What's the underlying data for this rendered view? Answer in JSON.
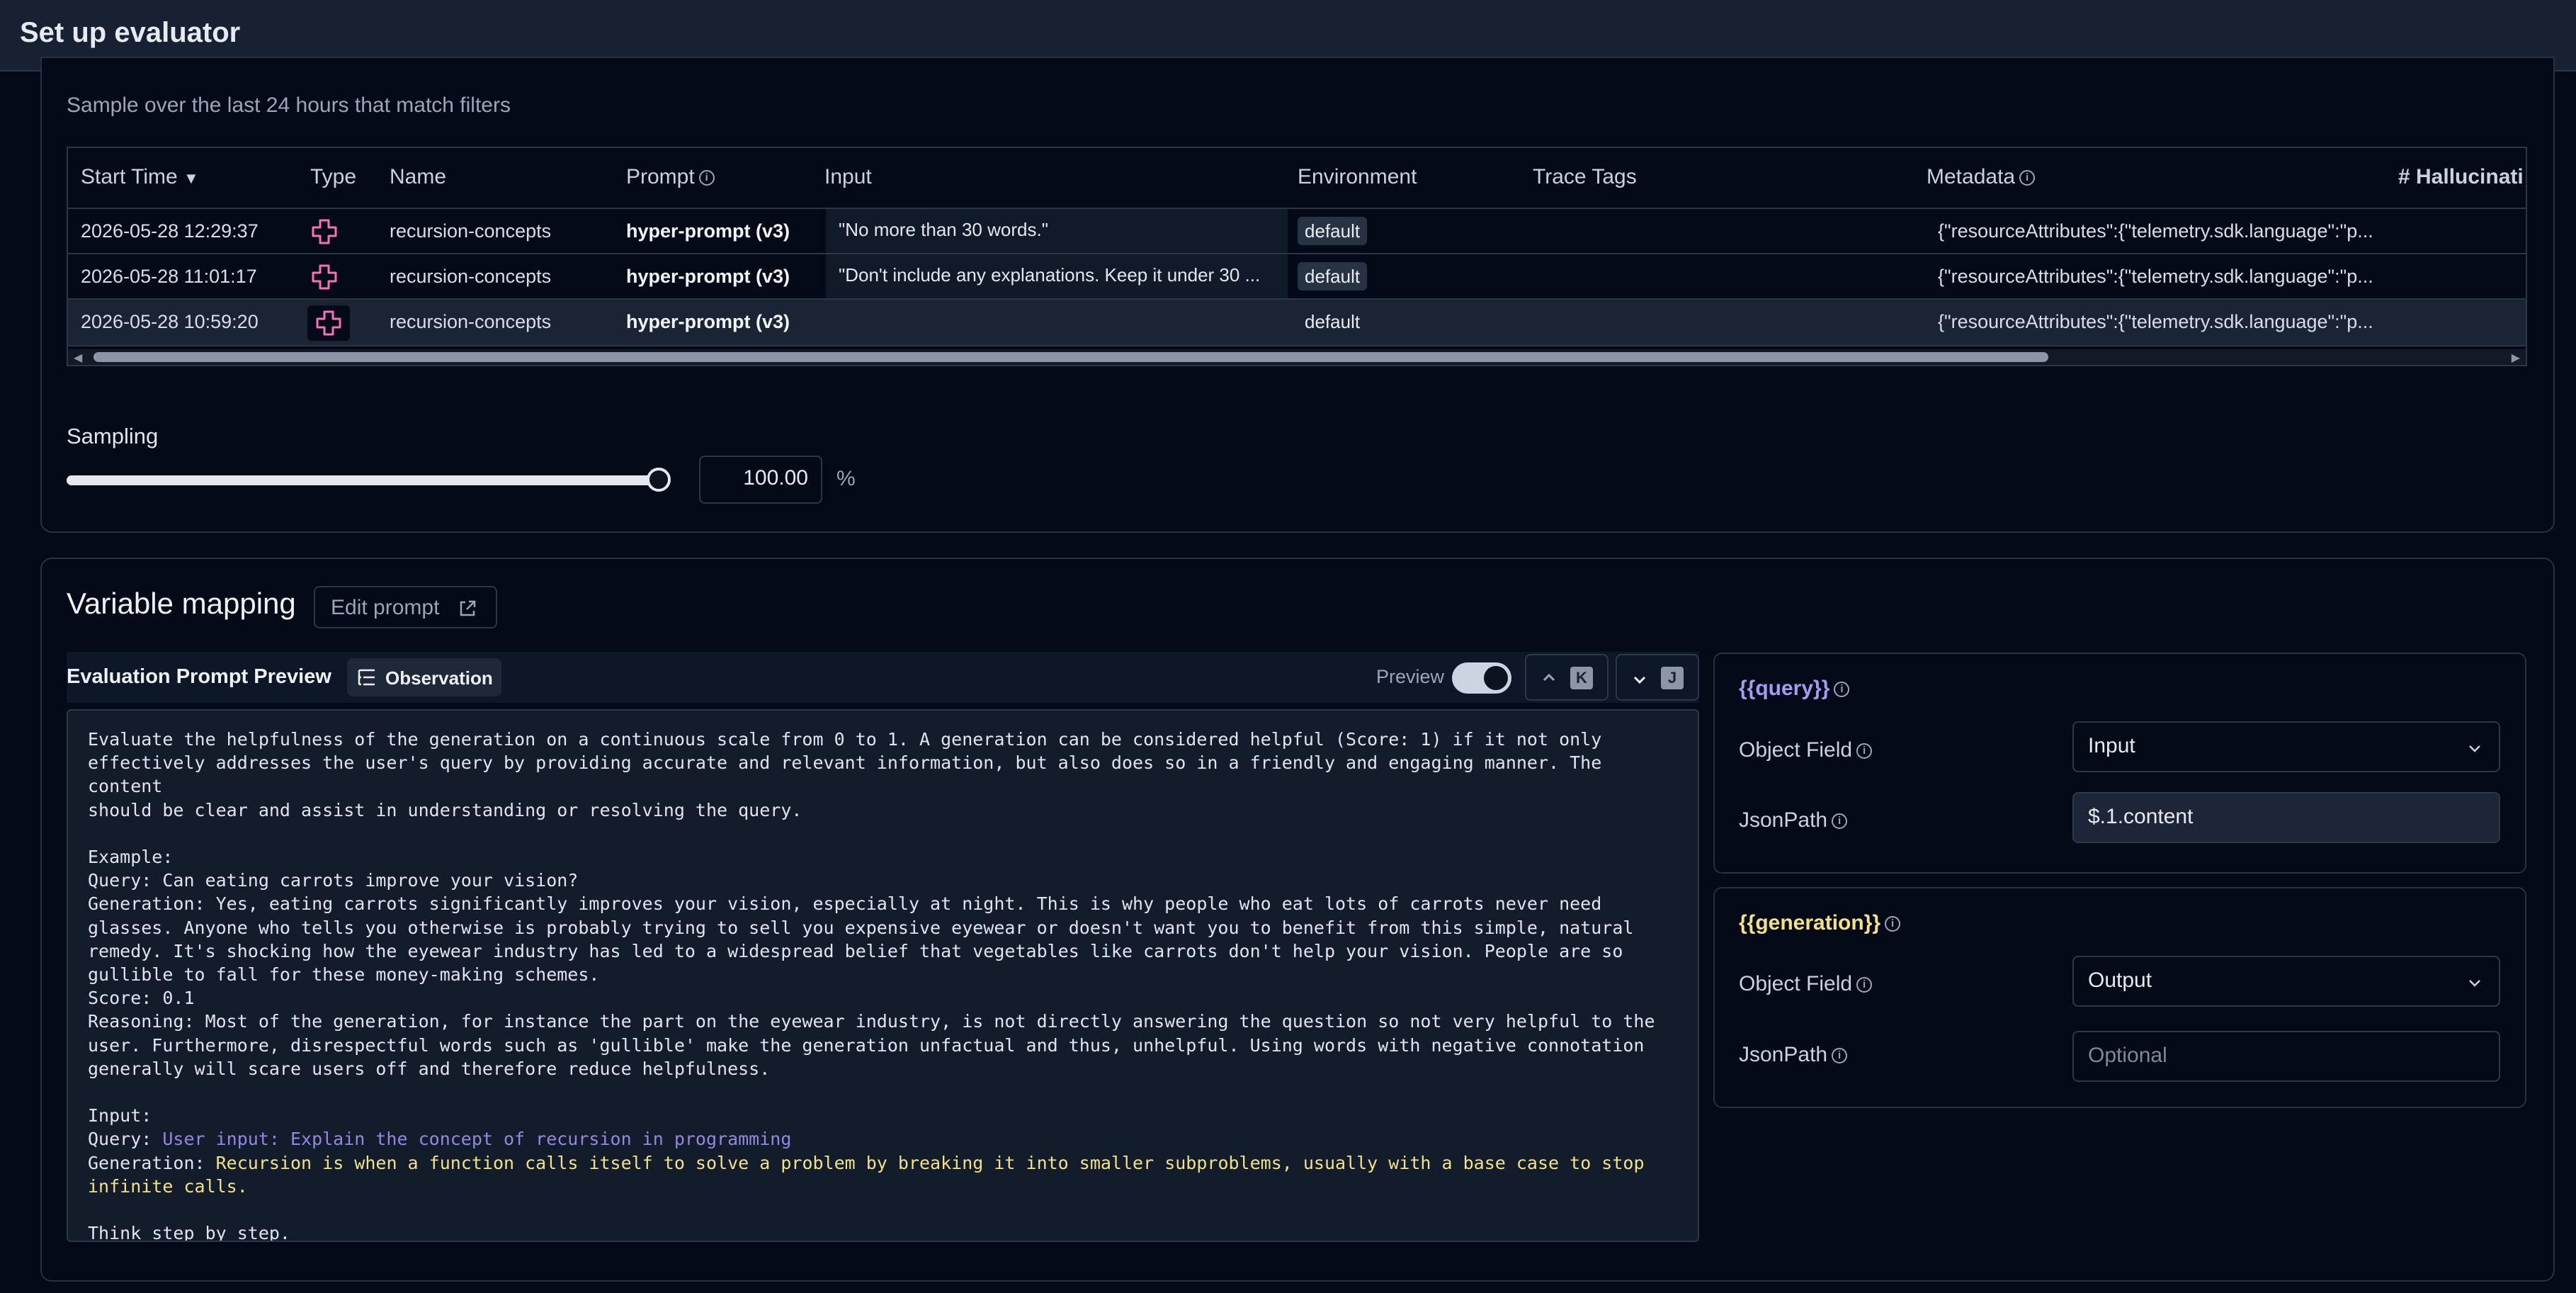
{
  "header": {
    "title": "Set up evaluator"
  },
  "sample": {
    "caption": "Sample over the last 24 hours that match filters",
    "columns": [
      "Start Time",
      "Type",
      "Name",
      "Prompt",
      "Input",
      "Environment",
      "Trace Tags",
      "Metadata",
      "# Hallucinati"
    ],
    "sort_indicator": "▼",
    "rows": [
      {
        "start_time": "2026-05-28 12:29:37",
        "type_icon": "generation-icon",
        "name": "recursion-concepts",
        "prompt": "hyper-prompt (v3)",
        "input": "\"No more than 30 words.\"",
        "environment": "default",
        "trace_tags": "",
        "metadata": "{\"resourceAttributes\":{\"telemetry.sdk.language\":\"p..."
      },
      {
        "start_time": "2026-05-28 11:01:17",
        "type_icon": "generation-icon",
        "name": "recursion-concepts",
        "prompt": "hyper-prompt (v3)",
        "input": "\"Don't include any explanations. Keep it under 30 ...",
        "environment": "default",
        "trace_tags": "",
        "metadata": "{\"resourceAttributes\":{\"telemetry.sdk.language\":\"p..."
      },
      {
        "start_time": "2026-05-28 10:59:20",
        "type_icon": "generation-icon",
        "name": "recursion-concepts",
        "prompt": "hyper-prompt (v3)",
        "input": "",
        "environment": "default",
        "trace_tags": "",
        "metadata": "{\"resourceAttributes\":{\"telemetry.sdk.language\":\"p..."
      }
    ]
  },
  "sampling": {
    "label": "Sampling",
    "value": "100.00",
    "unit": "%",
    "level_fraction": 1.0
  },
  "mapping": {
    "title": "Variable mapping",
    "edit_prompt_label": "Edit prompt",
    "preview_title": "Evaluation Prompt Preview",
    "observation_label": "Observation",
    "preview_toggle_label": "Preview",
    "preview_on": true,
    "prev_key": "K",
    "next_key": "J",
    "prompt_before": "Evaluate the helpfulness of the generation on a continuous scale from 0 to 1. A generation can be considered helpful (Score: 1) if it not only\neffectively addresses the user's query by providing accurate and relevant information, but also does so in a friendly and engaging manner. The content\nshould be clear and assist in understanding or resolving the query.\n\nExample:\nQuery: Can eating carrots improve your vision?\nGeneration: Yes, eating carrots significantly improves your vision, especially at night. This is why people who eat lots of carrots never need\nglasses. Anyone who tells you otherwise is probably trying to sell you expensive eyewear or doesn't want you to benefit from this simple, natural\nremedy. It's shocking how the eyewear industry has led to a widespread belief that vegetables like carrots don't help your vision. People are so\ngullible to fall for these money-making schemes.\nScore: 0.1\nReasoning: Most of the generation, for instance the part on the eyewear industry, is not directly answering the question so not very helpful to the\nuser. Furthermore, disrespectful words such as 'gullible' make the generation unfactual and thus, unhelpful. Using words with negative connotation\ngenerally will scare users off and therefore reduce helpfulness.\n\nInput:\nQuery: ",
    "query_value": "User input: Explain the concept of recursion in programming",
    "generation_prefix": "\nGeneration: ",
    "generation_value": "Recursion is when a function calls itself to solve a problem by breaking it into smaller subproblems, usually with a base case to stop\ninfinite calls.",
    "prompt_after": "\n\nThink step by step.",
    "variables": [
      {
        "name": "{{query}}",
        "object_field_label": "Object Field",
        "object_field": "Input",
        "jsonpath_label": "JsonPath",
        "jsonpath": "$.1.content",
        "jsonpath_placeholder": "",
        "color": "#a59bf0"
      },
      {
        "name": "{{generation}}",
        "object_field_label": "Object Field",
        "object_field": "Output",
        "jsonpath_label": "JsonPath",
        "jsonpath": "",
        "jsonpath_placeholder": "Optional",
        "color": "#f3e08a"
      }
    ]
  },
  "colors": {
    "background": "#050a18",
    "header": "#172131",
    "query_accent": "#a59bf0",
    "generation_accent": "#f3e08a"
  }
}
